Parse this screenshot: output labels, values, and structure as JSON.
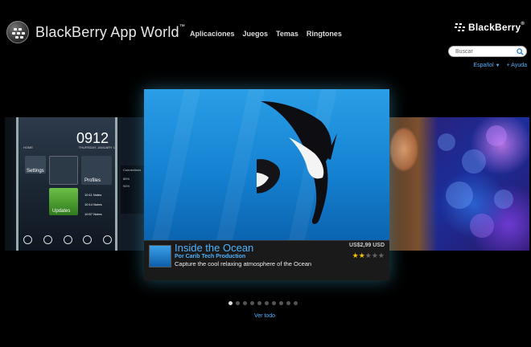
{
  "header": {
    "app_title": "BlackBerry App World",
    "trademark": "™",
    "brand": "BlackBerry",
    "brand_mark": "®",
    "nav": [
      "Aplicaciones",
      "Juegos",
      "Temas",
      "Ringtones"
    ]
  },
  "search": {
    "placeholder": "Buscar"
  },
  "utility": {
    "language": "Español",
    "help": "+ Ayuda"
  },
  "left_card": {
    "time": "0912",
    "date_left": "HOME",
    "date_right": "THURSDAY, JANUARY 1",
    "tiles": [
      "Settings",
      "Profiles",
      "Updates"
    ],
    "notes": [
      "10:11 Notes",
      "10:14 Notes",
      "10:57 Notes"
    ],
    "connections_label": "Connections",
    "connections": [
      "85%",
      "94%"
    ]
  },
  "featured": {
    "title": "Inside the Ocean",
    "author": "Por Carib Tech Production",
    "description": "Capture the cool relaxing atmosphere of the Ocean",
    "price": "US$2,99 USD",
    "rating": 2,
    "rating_max": 5
  },
  "carousel": {
    "dot_count": 10,
    "active_dot": 0,
    "view_all": "Ver todo"
  },
  "colors": {
    "accent": "#4fb3ff",
    "star": "#f2c200"
  }
}
